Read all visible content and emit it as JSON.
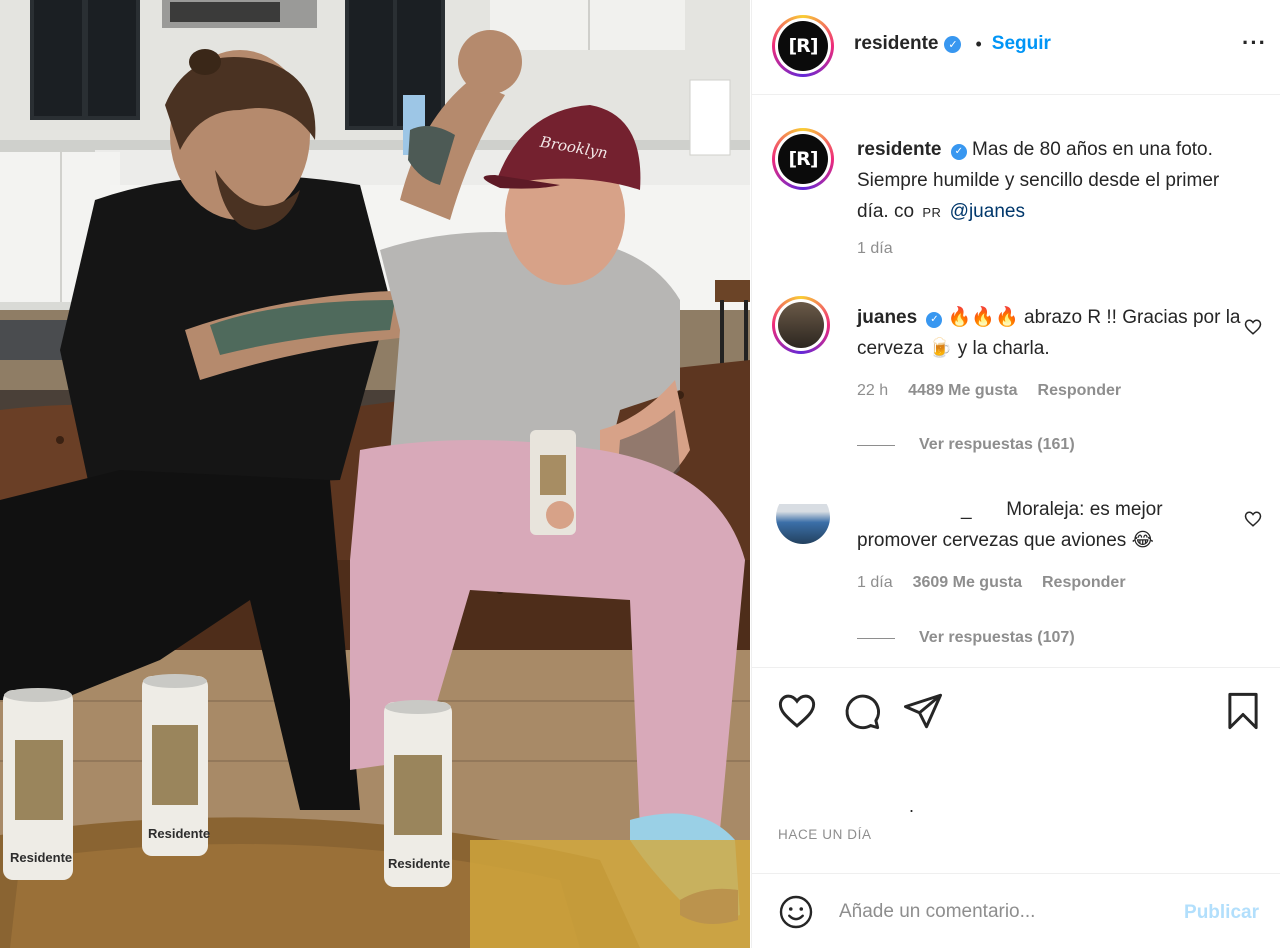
{
  "post": {
    "photo": {
      "cap_text": "Brooklyn",
      "can_label": "Residente"
    }
  },
  "header": {
    "avatar_text": "[R]",
    "username": "residente",
    "verified_icon": "verified-badge-icon",
    "separator": "•",
    "follow_label": "Seguir",
    "more_label": "···"
  },
  "caption": {
    "avatar_text": "[R]",
    "username": "residente",
    "text": "Mas de 80 años en una foto. Siempre humilde y sencillo desde el primer día. co",
    "pr_tag": "PR",
    "mention": "@juanes",
    "time": "1 día"
  },
  "comments": [
    {
      "username": "juanes",
      "text": "🔥🔥🔥 abrazo R !! Gracias por la cerveza 🍺 y la charla.",
      "time": "22 h",
      "likes": "4489 Me gusta",
      "reply_label": "Responder",
      "view_replies": "Ver respuestas (161)"
    },
    {
      "username": "_",
      "text": "Moraleja: es mejor promover cervezas que aviones 😂",
      "time": "1 día",
      "likes": "3609 Me gusta",
      "reply_label": "Responder",
      "view_replies": "Ver respuestas (107)"
    }
  ],
  "actions": {
    "like_icon": "heart-icon",
    "comment_icon": "comment-bubble-icon",
    "share_icon": "paper-plane-icon",
    "save_icon": "bookmark-icon",
    "likes_text": ".",
    "timestamp": "HACE UN DÍA"
  },
  "add_comment": {
    "emoji_icon": "smiley-icon",
    "placeholder": "Añade un comentario...",
    "publish_label": "Publicar"
  },
  "colors": {
    "accent": "#0095f6",
    "verified": "#3897f0",
    "muted": "#8e8e8e",
    "publish_disabled": "#b2dffc"
  }
}
